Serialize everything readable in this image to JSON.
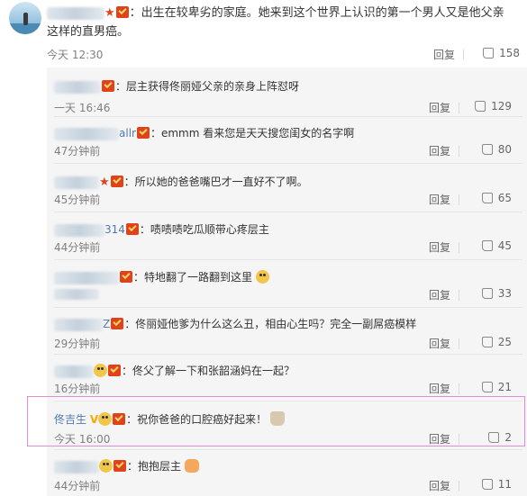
{
  "main_comment": {
    "text": "：出生在较卑劣的家庭。她来到这个世界上认识的第一个男人又是他父亲这样的直男癌。",
    "time": "今天 12:30",
    "reply_label": "回复",
    "likes": "158"
  },
  "replies": [
    {
      "username": "",
      "text": "：层主获得佟丽娅父亲的亲身上阵怼呀",
      "time": "一天 16:46",
      "reply_label": "回复",
      "likes": "129"
    },
    {
      "username": "allr",
      "text": "：emmm 看来您是天天搜您闺女的名字啊",
      "time": "47分钟前",
      "reply_label": "回复",
      "likes": "80"
    },
    {
      "username": "",
      "text": "：所以她的爸爸嘴巴才一直好不了啊。",
      "time": "45分钟前",
      "reply_label": "回复",
      "likes": "65"
    },
    {
      "username": "314",
      "text": "：啧啧啧吃瓜顺带心疼层主",
      "time": "44分钟前",
      "reply_label": "回复",
      "likes": "45"
    },
    {
      "username": "",
      "text": "：特地翻了一路翻到这里",
      "time": "",
      "reply_label": "回复",
      "likes": "33"
    },
    {
      "username": "",
      "text": "：佟丽娅他爹为什么这么丑，相由心生吗？完全一副屌癌模样",
      "time": "29分钟前",
      "reply_label": "回复",
      "likes": "25"
    },
    {
      "username": "",
      "text": "：佟父了解一下和张韶涵妈在一起？",
      "time": "16分钟前",
      "reply_label": "回复",
      "likes": "21"
    },
    {
      "username": "佟吉生",
      "vbadge": "V",
      "text": "：祝你爸爸的口腔癌好起来！",
      "time": "今天 16:00",
      "reply_label": "回复",
      "likes": "2"
    },
    {
      "username": "",
      "text": "：抱抱层主",
      "time": "44分钟前",
      "reply_label": "回复",
      "likes": "11"
    }
  ]
}
